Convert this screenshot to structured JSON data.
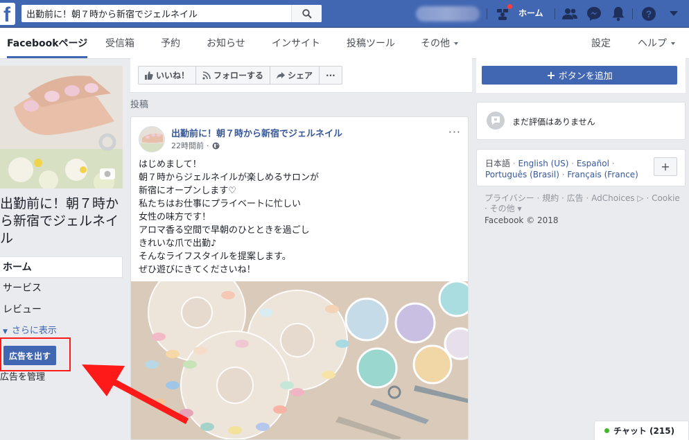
{
  "topbar": {
    "search_value": "出勤前に！朝７時から新宿でジェルネイル",
    "home_label": "ホーム",
    "brand_color": "#4267b2"
  },
  "pagenav": {
    "tabs": [
      {
        "label": "Facebookページ"
      },
      {
        "label": "受信箱"
      },
      {
        "label": "予約"
      },
      {
        "label": "お知らせ"
      },
      {
        "label": "インサイト"
      },
      {
        "label": "投稿ツール"
      },
      {
        "label": "その他"
      }
    ],
    "settings_label": "設定",
    "help_label": "ヘルプ"
  },
  "page": {
    "name": "出勤前に！朝７時から新宿でジェルネイル",
    "left_nav": [
      {
        "label": "ホーム"
      },
      {
        "label": "サービス"
      },
      {
        "label": "レビュー"
      }
    ],
    "see_more": "さらに表示",
    "ad_button": "広告を出す",
    "manage_ads": "広告を管理"
  },
  "actions": {
    "like": "いいね！",
    "follow": "フォローする",
    "share": "シェア",
    "more": "···",
    "add_button": "ボタンを追加"
  },
  "posts_label": "投稿",
  "post": {
    "author": "出勤前に！朝７時から新宿でジェルネイル",
    "time": "22時間前",
    "more": "···",
    "lines": [
      "はじめまして！",
      "朝７時からジェルネイルが楽しめるサロンが",
      "新宿にオープンします♡",
      "私たちはお仕事にプライベートに忙しい",
      "女性の味方です！",
      "アロマ香る空間で早朝のひとときを過ごし",
      "きれいな爪で出勤♪",
      "そんなライフスタイルを提案します。",
      "ぜひ遊びにきてくださいね！"
    ]
  },
  "sidebar": {
    "rating_text": "まだ評価はありません",
    "lang_current": "日本語",
    "languages": [
      "English (US)",
      "Español",
      "Português (Brasil)",
      "Français (France)"
    ],
    "footer_links": "プライバシー · 規約 · 広告 · AdChoices ▷ · Cookie · その他 ▾",
    "copyright": "Facebook © 2018"
  },
  "chat": {
    "label": "チャット (215)"
  }
}
